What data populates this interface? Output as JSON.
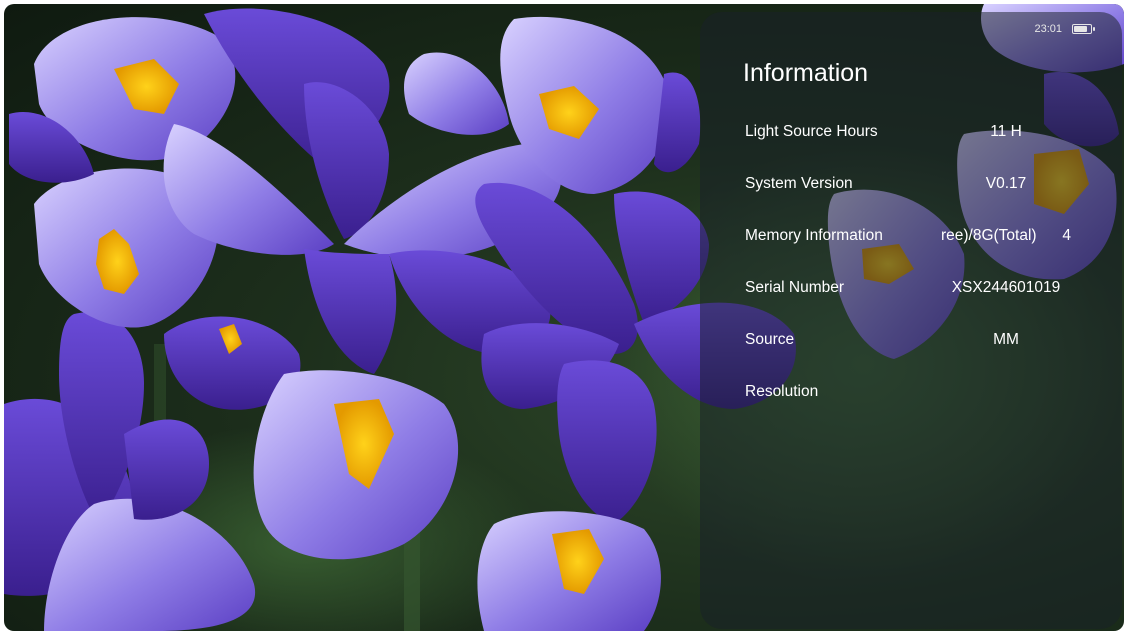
{
  "status": {
    "time": "23:01",
    "battery_level": 0.9
  },
  "panel": {
    "title": "Information",
    "rows": [
      {
        "label": "Light Source Hours",
        "value": "11 H"
      },
      {
        "label": "System Version",
        "value": "V0.17"
      },
      {
        "label": "Memory Information",
        "value": "ree)/8G(Total)      4"
      },
      {
        "label": "Serial Number",
        "value": "XSX244601019"
      },
      {
        "label": "Source",
        "value": "MM"
      },
      {
        "label": "Resolution",
        "value": ""
      }
    ]
  },
  "colors": {
    "petal": "#8a6fe0",
    "petal_dark": "#4b2aa8",
    "center": "#f2b705",
    "foliage": "#2b4426",
    "panel_bg": "rgba(25,32,40,0.52)"
  }
}
